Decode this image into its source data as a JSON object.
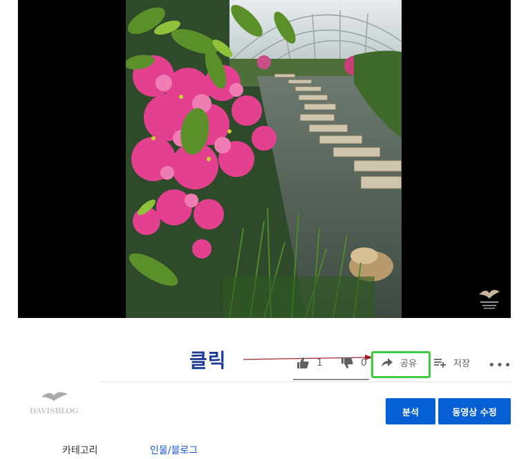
{
  "annotation": {
    "label": "클릭",
    "highlight_color": "#3fcc3f",
    "arrow_color": "#a0232f"
  },
  "actions": {
    "like_count": "1",
    "dislike_count": "0",
    "share_label": "공유",
    "save_label": "저장",
    "more_label": "•••"
  },
  "channel": {
    "logo_text": "DAVISBLOG"
  },
  "buttons": {
    "analytics_label": "분석",
    "edit_video_label": "동영상 수정"
  },
  "details": {
    "category_label": "카테고리",
    "category_value": "인물/블로그"
  },
  "colors": {
    "accent": "#065fd4",
    "player_bg": "#000000",
    "link": "#1558d6"
  },
  "icons": [
    "thumbs-up-icon",
    "thumbs-down-icon",
    "share-arrow-icon",
    "save-playlist-icon",
    "more-icon"
  ]
}
